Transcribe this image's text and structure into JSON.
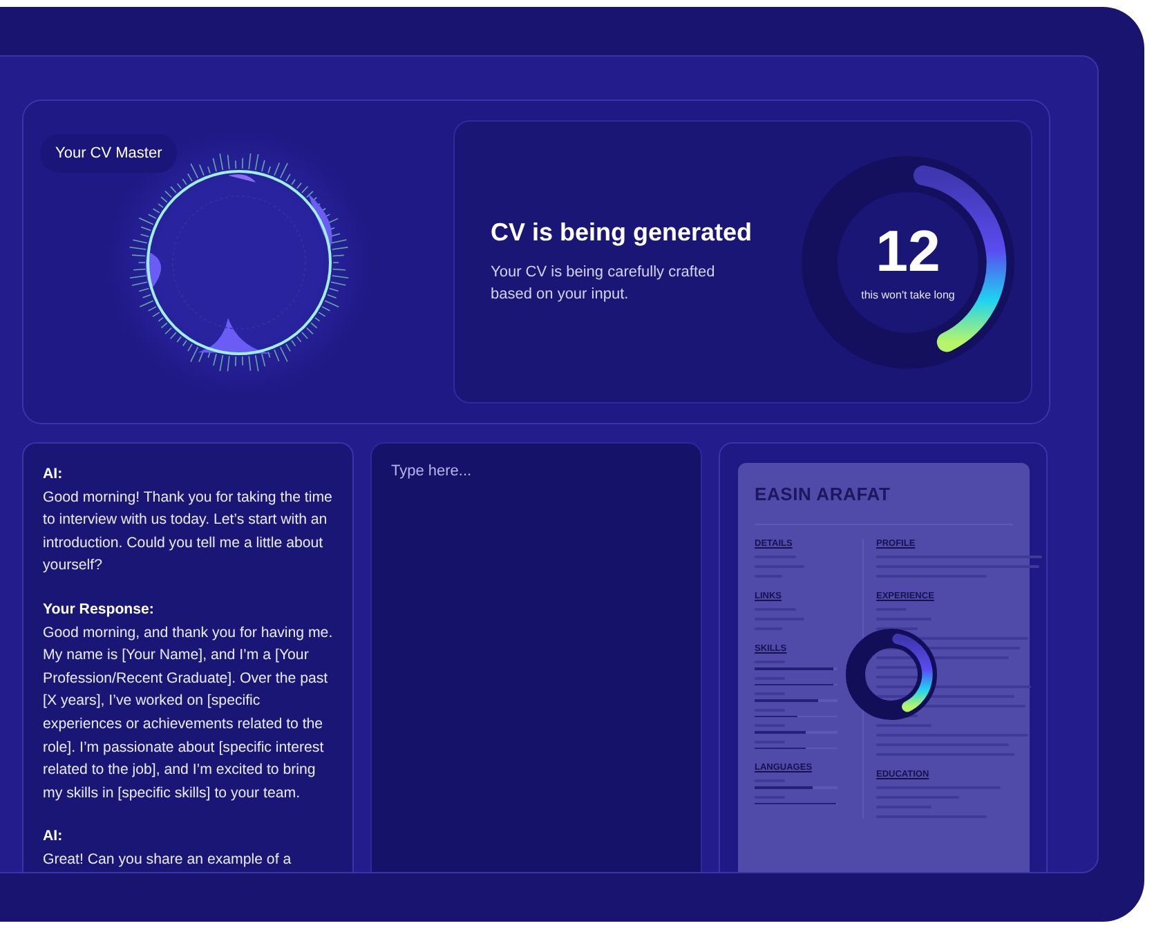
{
  "assistant": {
    "badge": "Your CV Master"
  },
  "status": {
    "title": "CV is being generated",
    "description": "Your CV is being  carefully crafted based on your input.",
    "countdown": "12",
    "caption": "this won't take long",
    "level": 0.4
  },
  "chat": [
    {
      "speaker": "AI:",
      "text": "Good morning! Thank you for taking the time to interview with us today. Let’s start with an introduction. Could you tell me a little about yourself?"
    },
    {
      "speaker": "Your Response:",
      "text": "Good morning, and thank you for having me. My name is [Your Name], and I’m a [Your Profession/Recent Graduate]. Over the past [X years], I’ve worked on [specific experiences or achievements related to the role]. I’m passionate about [specific interest related to the job], and I’m excited to bring my skills in [specific skills] to your team."
    },
    {
      "speaker": "AI:",
      "text": "Great! Can you share an example of a"
    }
  ],
  "reply_input": {
    "placeholder": "Type here..."
  },
  "cv": {
    "name": "EASIN ARAFAT",
    "left_sections": [
      {
        "heading": "DETAILS",
        "kind": "lines"
      },
      {
        "heading": "LINKS",
        "kind": "lines"
      },
      {
        "heading": "SKILLS",
        "kind": "bars",
        "bars": [
          {
            "level": 0.95
          },
          {
            "level": 0.95
          },
          {
            "level": 0.77
          },
          {
            "level": 0.52
          },
          {
            "level": 0.62
          },
          {
            "level": 0.62
          }
        ]
      },
      {
        "heading": "LANGUAGES",
        "kind": "bars",
        "bars": [
          {
            "level": 0.7
          },
          {
            "level": 0.98
          }
        ]
      }
    ],
    "right_sections": [
      {
        "heading": "PROFILE"
      },
      {
        "heading": "EXPERIENCE"
      },
      {
        "heading": "EDUCATION"
      }
    ],
    "progress_ring": {
      "level": 0.4
    }
  }
}
